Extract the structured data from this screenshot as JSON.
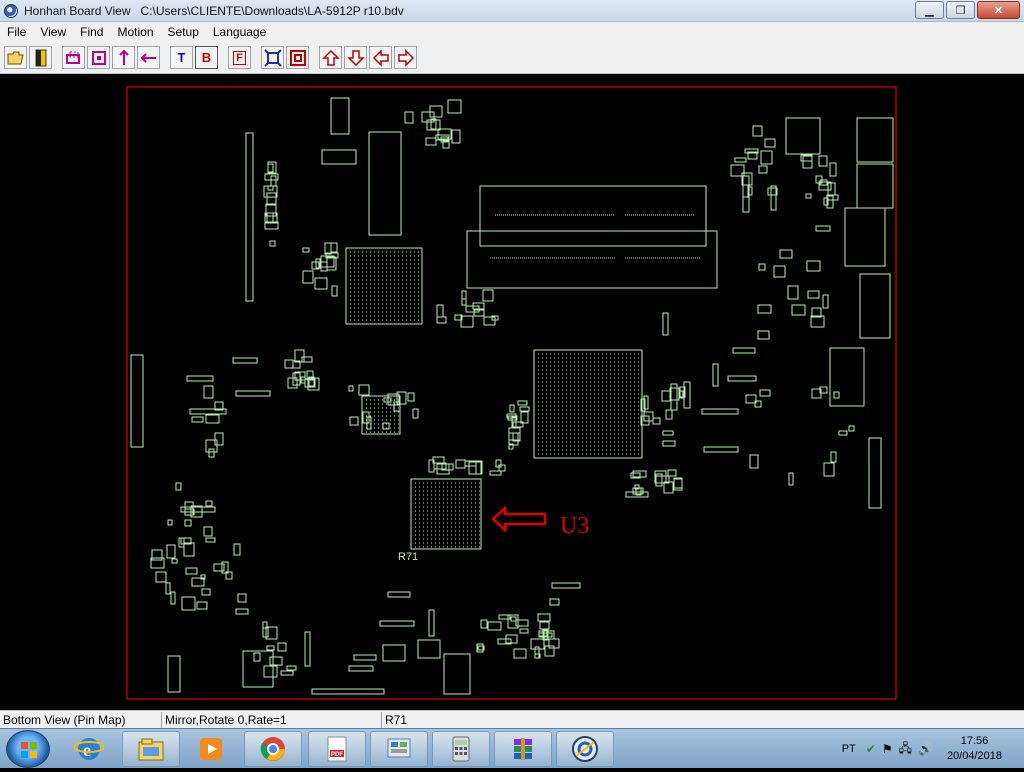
{
  "titlebar": {
    "app": "Honhan Board View",
    "file": "C:\\Users\\CLIENTE\\Downloads\\LA-5912P r10.bdv"
  },
  "menu": [
    "File",
    "View",
    "Find",
    "Motion",
    "Setup",
    "Language"
  ],
  "toolbar": {
    "buttons": [
      {
        "name": "open-file-button",
        "icon": "folder-open-icon"
      },
      {
        "name": "exit-button",
        "icon": "door-icon"
      },
      {
        "name": "zoom-area-button",
        "icon": "zoom-area-icon"
      },
      {
        "name": "zoom-fit-button",
        "icon": "zoom-fit-icon"
      },
      {
        "name": "flip-vertical-button",
        "icon": "flip-vertical-icon"
      },
      {
        "name": "flip-horizontal-button",
        "icon": "flip-horizontal-icon"
      },
      {
        "name": "top-side-button",
        "label": "T",
        "color": "#0000cc"
      },
      {
        "name": "bottom-side-button",
        "label": "B",
        "color": "#cc0000"
      },
      {
        "name": "fill-button",
        "label": "F",
        "color": "#cc0000"
      },
      {
        "name": "zoom-in-button",
        "icon": "zoom-in-icon"
      },
      {
        "name": "zoom-out-button",
        "icon": "zoom-out-icon"
      },
      {
        "name": "pan-up-button",
        "icon": "arrow-up-icon"
      },
      {
        "name": "pan-down-button",
        "icon": "arrow-down-icon"
      },
      {
        "name": "pan-left-button",
        "icon": "arrow-left-icon"
      },
      {
        "name": "pan-right-button",
        "icon": "arrow-right-icon"
      }
    ]
  },
  "board": {
    "outline_color": "#e00000",
    "trace_color": "#b8f0b0",
    "annotation_label": "U3",
    "annotation_color": "#e00000",
    "component_label": "R71"
  },
  "status": {
    "view": "Bottom View (Pin Map)",
    "transform": "Mirror,Rotate 0,Rate=1",
    "selected": "R71"
  },
  "taskbar": {
    "apps": [
      "explorer-icon",
      "ie-icon",
      "file-manager-icon",
      "media-player-icon",
      "chrome-icon",
      "pdf-reader-icon",
      "control-panel-icon",
      "calculator-icon",
      "winrar-icon",
      "honhan-boardview-icon"
    ],
    "language": "PT",
    "time": "17:56",
    "date": "20/04/2018"
  }
}
